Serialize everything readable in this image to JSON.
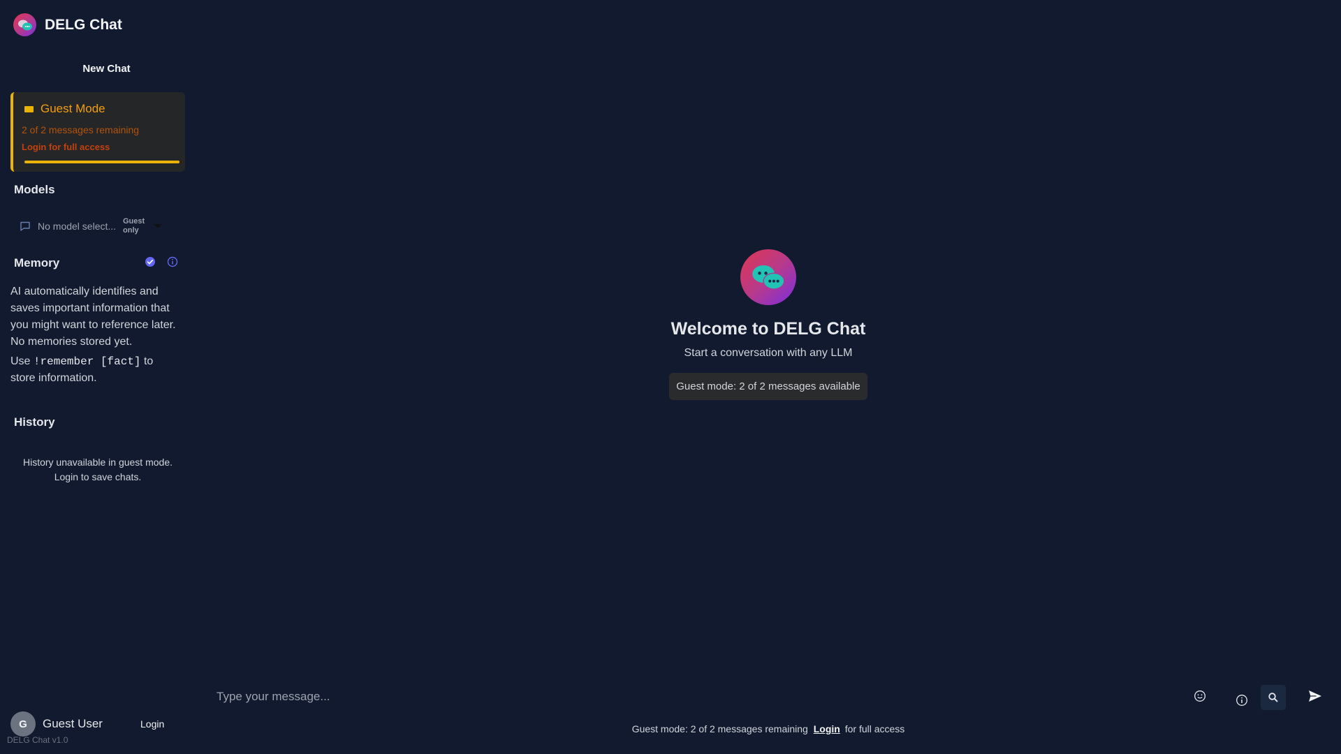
{
  "app": {
    "title": "DELG Chat",
    "version": "DELG Chat v1.0"
  },
  "sidebar": {
    "new_chat_label": "New Chat",
    "guest_card": {
      "title": "Guest Mode",
      "remaining": "2 of 2 messages remaining",
      "login_text": "Login for full access",
      "progress": 1.0
    },
    "models": {
      "title": "Models",
      "selected": "No model select...",
      "badge_line1": "Guest",
      "badge_line2": "only"
    },
    "memory": {
      "title": "Memory",
      "description": "AI automatically identifies and saves important information that you might want to reference later.",
      "empty": "No memories stored yet.",
      "use_prefix": "Use",
      "command": "!remember [fact]",
      "use_suffix": "to store information."
    },
    "history": {
      "title": "History",
      "line1": "History unavailable in guest mode.",
      "line2": "Login to save chats."
    },
    "user": {
      "initial": "G",
      "name": "Guest User",
      "login_label": "Login"
    }
  },
  "main": {
    "welcome_title": "Welcome to DELG Chat",
    "welcome_subtitle": "Start a conversation with any LLM",
    "guest_pill": "Guest mode: 2 of 2 messages available",
    "input_placeholder": "Type your message...",
    "footer_prefix": "Guest mode: 2 of 2 messages remaining",
    "footer_link": "Login",
    "footer_suffix": "for full access"
  },
  "colors": {
    "background": "#111a2e",
    "accent_yellow": "#eab308",
    "accent_orange": "#f59e0b",
    "check_blue": "#6366f1"
  },
  "icons": [
    "chat-bubbles-icon",
    "chat-icon",
    "chevron-down-icon",
    "check-badge-icon",
    "info-icon",
    "emoji-icon",
    "search-icon",
    "send-icon"
  ]
}
